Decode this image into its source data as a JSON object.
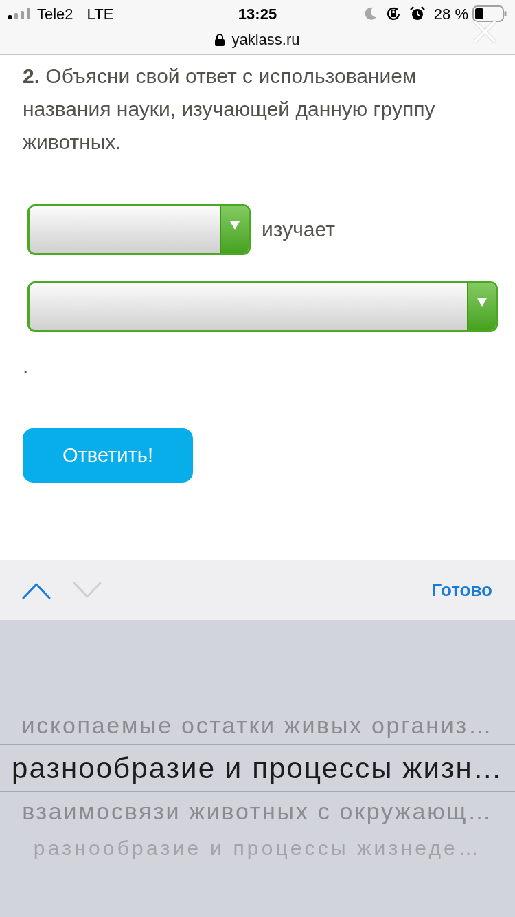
{
  "status_bar": {
    "carrier": "Tele2",
    "network": "LTE",
    "time": "13:25",
    "battery": "28 %"
  },
  "address_bar": {
    "url": "yaklass.ru"
  },
  "question": {
    "text": "**2.** Объясни свой ответ с использованием названия науки, изучающей данную группу животных."
  },
  "answer_parts": [
    {
      "kind": "dropdown"
    },
    {
      "kind": "word",
      "text": "изучает"
    },
    {
      "kind": "dropdown_wide"
    },
    {
      "kind": "word",
      "text": "."
    }
  ],
  "submit_button": {
    "label": "Ответить!"
  },
  "keyboard_toolbar": {
    "previous": {
      "disabled": false
    },
    "next": {
      "disabled": true
    },
    "done": "Готово"
  },
  "picker": {
    "options": [
      {
        "label": "ископаемые остатки живых организ…",
        "selected": false
      },
      {
        "label": "разнообразие и процессы жизн…",
        "selected": true
      },
      {
        "label": "взаимосвязи животных с окружающ…",
        "selected": false
      },
      {
        "label": "разнообразие и процессы жизнеде…",
        "selected": false
      }
    ]
  }
}
